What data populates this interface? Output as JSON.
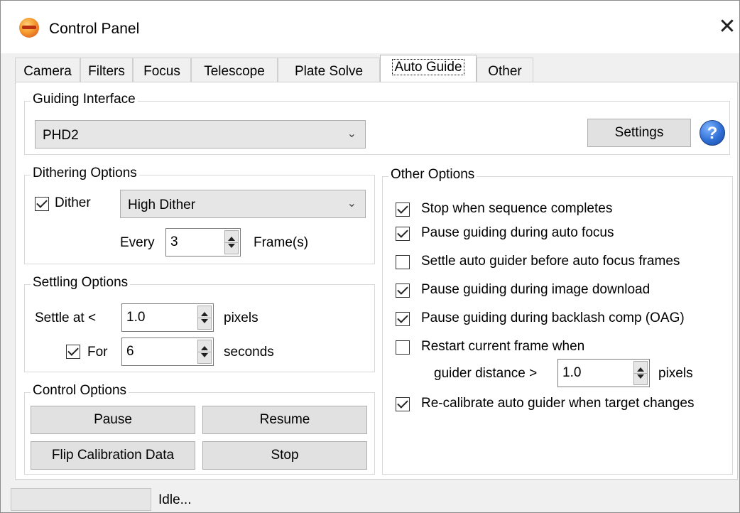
{
  "window": {
    "title": "Control Panel",
    "close_glyph": "✕"
  },
  "tabs": [
    {
      "label": "Camera"
    },
    {
      "label": "Filters"
    },
    {
      "label": "Focus"
    },
    {
      "label": "Telescope"
    },
    {
      "label": "Plate Solve"
    },
    {
      "label": "Auto Guide",
      "active": true
    },
    {
      "label": "Other"
    }
  ],
  "guiding_interface": {
    "title": "Guiding Interface",
    "selected": "PHD2",
    "settings_label": "Settings",
    "help_glyph": "?"
  },
  "dithering": {
    "title": "Dithering Options",
    "dither_label": "Dither",
    "dither_checked": true,
    "mode": "High Dither",
    "every_label": "Every",
    "every_value": "3",
    "frames_label": "Frame(s)"
  },
  "settling": {
    "title": "Settling Options",
    "settle_label": "Settle at <",
    "settle_value": "1.0",
    "pixels_label": "pixels",
    "for_label": "For",
    "for_checked": true,
    "for_value": "6",
    "seconds_label": "seconds"
  },
  "control": {
    "title": "Control Options",
    "pause": "Pause",
    "resume": "Resume",
    "flip": "Flip Calibration Data",
    "stop": "Stop"
  },
  "other": {
    "title": "Other Options",
    "options": [
      {
        "label": "Stop when sequence completes",
        "checked": true
      },
      {
        "label": "Pause guiding during auto focus",
        "checked": true
      },
      {
        "label": "Settle auto guider before auto focus frames",
        "checked": false
      },
      {
        "label": "Pause guiding during image download",
        "checked": true
      },
      {
        "label": "Pause guiding during backlash comp (OAG)",
        "checked": true
      },
      {
        "label": "Restart current frame when",
        "checked": false
      },
      {
        "label": "Re-calibrate auto guider when target changes",
        "checked": true
      }
    ],
    "guider_distance_label": "guider distance >",
    "guider_distance_value": "1.0",
    "guider_pixels_label": "pixels"
  },
  "status": {
    "text": "Idle..."
  }
}
